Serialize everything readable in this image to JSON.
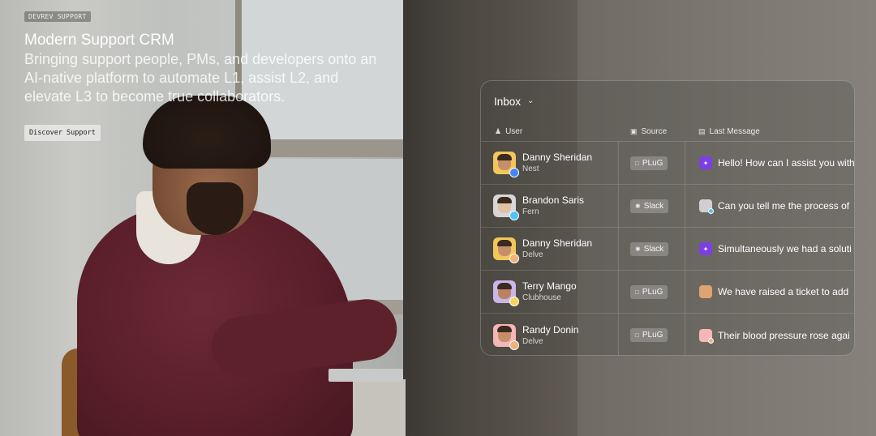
{
  "hero": {
    "tag": "DEVREV SUPPORT",
    "title": "Modern Support CRM",
    "subtitle": "Bringing support people, PMs, and developers onto an AI-native platform to automate L1, assist L2, and elevate L3 to become true collaborators.",
    "cta_label": "Discover Support"
  },
  "inbox": {
    "title": "Inbox",
    "columns": {
      "user": "User",
      "source": "Source",
      "last_message": "Last Message"
    },
    "rows": [
      {
        "name": "Danny Sheridan",
        "company": "Nest",
        "source": "PLuG",
        "source_icon": "chat-bubble-icon",
        "message": "Hello! How can I assist you with",
        "avatar_bg": "#f2c65a",
        "badge_color": "#4285f4",
        "msg_icon_bg": "#7b3fe4"
      },
      {
        "name": "Brandon Saris",
        "company": "Fern",
        "source": "Slack",
        "source_icon": "slack-icon",
        "message": "Can you tell me the process of",
        "avatar_bg": "#d7d7d7",
        "badge_color": "#4fc3f7",
        "msg_icon_bg": "#cfcfcf"
      },
      {
        "name": "Danny Sheridan",
        "company": "Delve",
        "source": "Slack",
        "source_icon": "slack-icon",
        "message": "Simultaneously we had a soluti",
        "avatar_bg": "#f2c65a",
        "badge_color": "#f0b27a",
        "msg_icon_bg": "#7b3fe4"
      },
      {
        "name": "Terry Mango",
        "company": "Clubhouse",
        "source": "PLuG",
        "source_icon": "chat-bubble-icon",
        "message": "We have raised a ticket to add",
        "avatar_bg": "#cbb6e8",
        "badge_color": "#f4d35e",
        "msg_icon_bg": "#e0a470"
      },
      {
        "name": "Randy Donin",
        "company": "Delve",
        "source": "PLuG",
        "source_icon": "chat-bubble-icon",
        "message": "Their blood pressure rose agai",
        "avatar_bg": "#f4b6b6",
        "badge_color": "#f0b27a",
        "msg_icon_bg": "#f4b6b6"
      }
    ]
  }
}
